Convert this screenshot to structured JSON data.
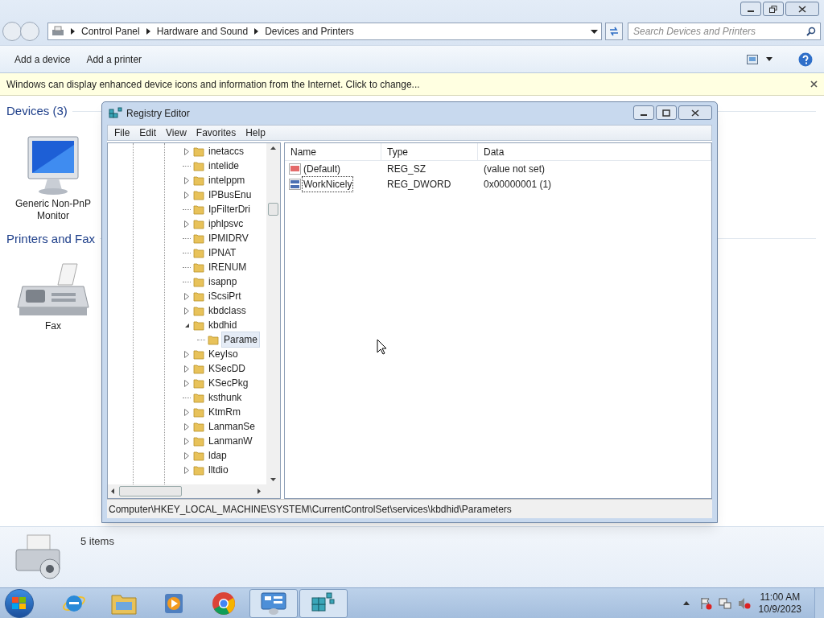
{
  "explorer": {
    "breadcrumb": [
      "Control Panel",
      "Hardware and Sound",
      "Devices and Printers"
    ],
    "search": {
      "placeholder": "Search Devices and Printers"
    },
    "toolbar": [
      "Add a device",
      "Add a printer"
    ],
    "info_bar": "Windows can display enhanced device icons and information from the Internet. Click to change...",
    "groups": [
      {
        "title": "Devices (3)",
        "items": [
          {
            "label": "Generic Non-PnP Monitor",
            "kind": "monitor"
          }
        ]
      },
      {
        "title": "Printers and Fax",
        "items": [
          {
            "label": "Fax",
            "kind": "fax"
          }
        ]
      }
    ],
    "details": "5 items"
  },
  "regedit": {
    "title": "Registry Editor",
    "menu": [
      "File",
      "Edit",
      "View",
      "Favorites",
      "Help"
    ],
    "tree": [
      {
        "label": "inetaccs",
        "kind": "branch",
        "expanded": false,
        "selected": false
      },
      {
        "label": "intelide",
        "kind": "leaf",
        "selected": false
      },
      {
        "label": "intelppm",
        "kind": "branch",
        "expanded": false,
        "selected": false
      },
      {
        "label": "IPBusEnu",
        "kind": "branch",
        "expanded": false,
        "selected": false
      },
      {
        "label": "IpFilterDri",
        "kind": "leaf",
        "selected": false
      },
      {
        "label": "iphlpsvc",
        "kind": "branch",
        "expanded": false,
        "selected": false
      },
      {
        "label": "IPMIDRV",
        "kind": "leaf",
        "selected": false
      },
      {
        "label": "IPNAT",
        "kind": "leaf",
        "selected": false
      },
      {
        "label": "IRENUM",
        "kind": "leaf",
        "selected": false
      },
      {
        "label": "isapnp",
        "kind": "leaf",
        "selected": false
      },
      {
        "label": "iScsiPrt",
        "kind": "branch",
        "expanded": false,
        "selected": false
      },
      {
        "label": "kbdclass",
        "kind": "branch",
        "expanded": false,
        "selected": false
      },
      {
        "label": "kbdhid",
        "kind": "branch",
        "expanded": true,
        "selected": false,
        "children": [
          {
            "label": "Parame",
            "kind": "leaf",
            "selected": true
          }
        ]
      },
      {
        "label": "KeyIso",
        "kind": "branch",
        "expanded": false,
        "selected": false
      },
      {
        "label": "KSecDD",
        "kind": "branch",
        "expanded": false,
        "selected": false
      },
      {
        "label": "KSecPkg",
        "kind": "branch",
        "expanded": false,
        "selected": false
      },
      {
        "label": "ksthunk",
        "kind": "leaf",
        "selected": false
      },
      {
        "label": "KtmRm",
        "kind": "branch",
        "expanded": false,
        "selected": false
      },
      {
        "label": "LanmanSe",
        "kind": "branch",
        "expanded": false,
        "selected": false
      },
      {
        "label": "LanmanW",
        "kind": "branch",
        "expanded": false,
        "selected": false
      },
      {
        "label": "ldap",
        "kind": "branch",
        "expanded": false,
        "selected": false
      },
      {
        "label": "lltdio",
        "kind": "branch",
        "expanded": false,
        "selected": false
      }
    ],
    "columns": [
      "Name",
      "Type",
      "Data"
    ],
    "values": [
      {
        "kind": "string",
        "name": "(Default)",
        "type": "REG_SZ",
        "data": "(value not set)",
        "focused": false
      },
      {
        "kind": "binary",
        "name": "WorkNicely",
        "type": "REG_DWORD",
        "data": "0x00000001 (1)",
        "focused": true
      }
    ],
    "status": "Computer\\HKEY_LOCAL_MACHINE\\SYSTEM\\CurrentControlSet\\services\\kbdhid\\Parameters"
  },
  "taskbar": {
    "apps": [
      {
        "kind": "browser",
        "selected": false
      },
      {
        "kind": "folder",
        "selected": false
      },
      {
        "kind": "media",
        "selected": false
      },
      {
        "kind": "chrome",
        "selected": false
      },
      {
        "kind": "panel",
        "selected": true
      },
      {
        "kind": "registry",
        "selected": true
      }
    ],
    "clock": {
      "time": "11:00 AM",
      "date": "10/9/2023"
    }
  }
}
